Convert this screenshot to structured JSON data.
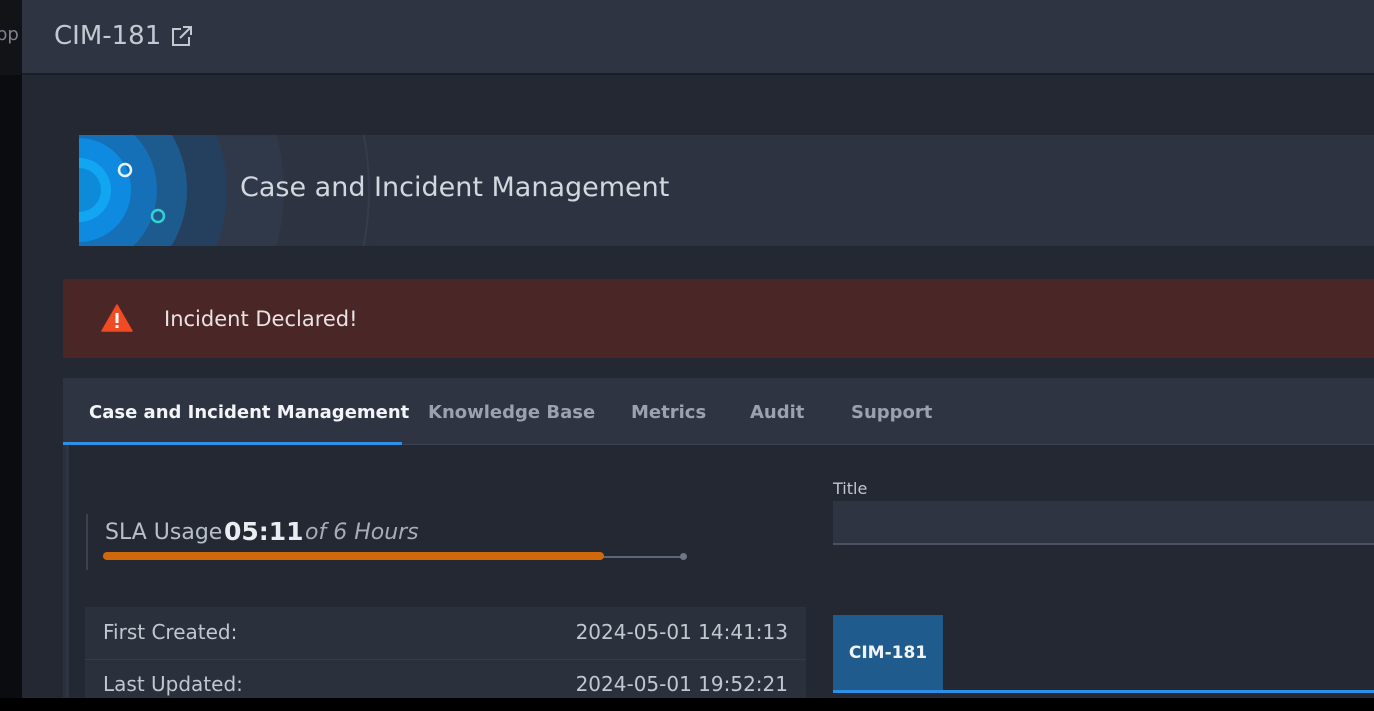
{
  "background_app": {
    "peek_text": "pp"
  },
  "modal": {
    "title": "CIM-181",
    "open_external_icon": "external-link-icon"
  },
  "banner": {
    "title": "Case and Incident Management"
  },
  "alert": {
    "icon": "warning-triangle-icon",
    "text": "Incident Declared!",
    "background_color": "#4b2626",
    "icon_color": "#f04b23"
  },
  "tabs": [
    {
      "label": "Case and Incident Management",
      "active": true
    },
    {
      "label": "Knowledge Base",
      "active": false
    },
    {
      "label": "Metrics",
      "active": false
    },
    {
      "label": "Audit",
      "active": false
    },
    {
      "label": "Support",
      "active": false
    }
  ],
  "sla": {
    "label": "SLA Usage",
    "value": "05:11",
    "of_text": "of 6 Hours",
    "used_fraction": 0.864,
    "bar_color": "#d1690b"
  },
  "meta": [
    {
      "label": "First Created:",
      "value": "2024-05-01 14:41:13"
    },
    {
      "label": "Last Updated:",
      "value": "2024-05-01 19:52:21"
    }
  ],
  "title_field": {
    "label": "Title",
    "value": ""
  },
  "case_tab": {
    "label": "CIM-181"
  },
  "colors": {
    "accent": "#2f8fe6",
    "case_tab": "#1f5b8c"
  }
}
